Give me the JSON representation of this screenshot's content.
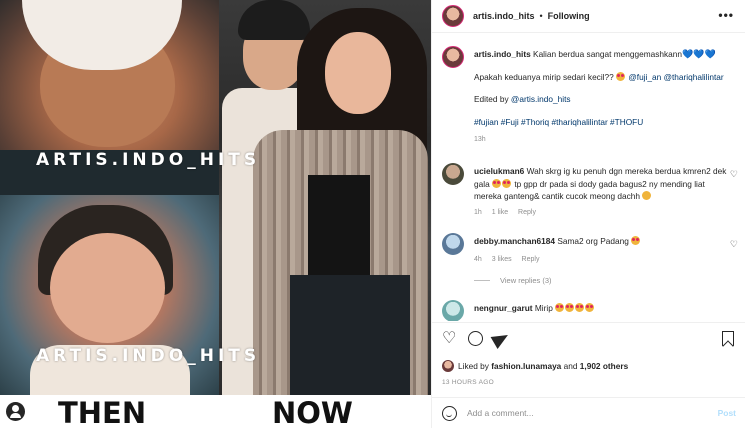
{
  "media": {
    "watermark": "ARTIS.INDO_HITS",
    "then_label": "THEN",
    "now_label": "NOW"
  },
  "header": {
    "username": "artis.indo_hits",
    "separator": "•",
    "follow_status": "Following",
    "more_label": "•••"
  },
  "caption": {
    "username": "artis.indo_hits",
    "text1": "Kalian berdua sangat menggemashkann",
    "hearts": "💙💙💙",
    "text2": "Apakah keduanya mirip sedari kecil??",
    "mention1": "@fuji_an",
    "mention2": "@thariqhalilintar",
    "edited_prefix": "Edited by",
    "edited_mention": "@artis.indo_hits",
    "hashtags": "#fujian #Fuji #Thoriq #thariqhalilintar #THOFU",
    "time": "13h"
  },
  "comments": [
    {
      "username": "ucielukman6",
      "text_a": "Wah skrg ig ku penuh dgn mereka berdua kmren2 dek gala",
      "text_b": "tp gpp dr pada si dody gada bagus2 ny mending liat mereka ganteng& cantik cucok meong dachh",
      "time": "1h",
      "likes": "1 like",
      "reply": "Reply"
    },
    {
      "username": "debby.manchan6184",
      "text_a": "Sama2 org Padang",
      "time": "4h",
      "likes": "3 likes",
      "reply": "Reply",
      "view_replies": "View replies (3)"
    },
    {
      "username": "nengnur_garut",
      "text_a": "Mirip"
    }
  ],
  "actions": {
    "liked_by_prefix": "Liked by",
    "liked_by_user": "fashion.lunamaya",
    "liked_by_and": "and",
    "liked_by_count": "1,902 others",
    "timestamp": "13 HOURS AGO"
  },
  "add_comment": {
    "placeholder": "Add a comment...",
    "post_label": "Post"
  },
  "colors": {
    "accent_link": "#00376b",
    "post_button": "#b2dffc",
    "meta_gray": "#8e8e8e"
  }
}
